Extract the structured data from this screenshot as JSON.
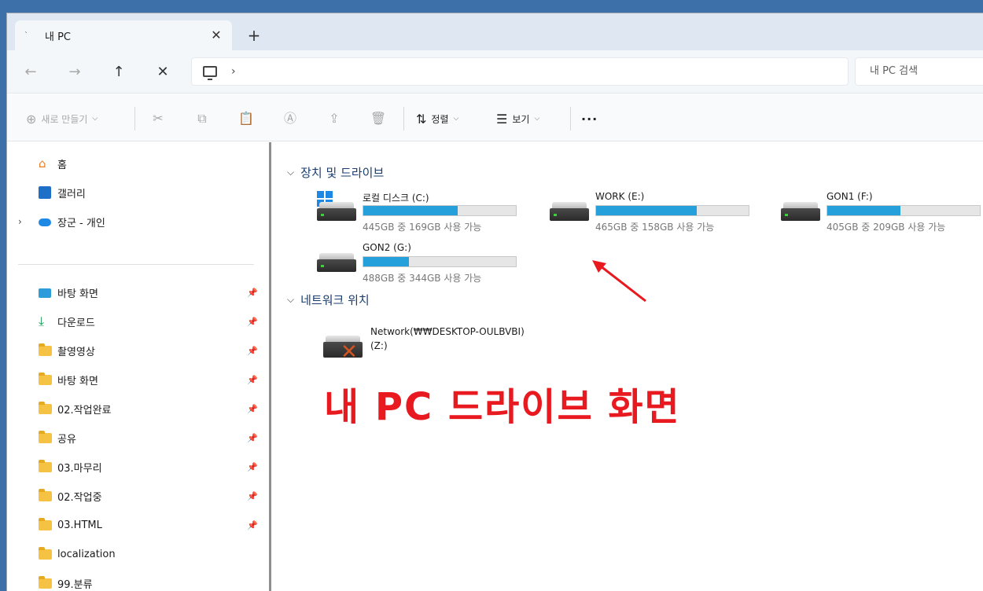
{
  "window": {
    "tab_label": "내 PC",
    "tab_close": "✕",
    "new_tab": "+"
  },
  "nav": {
    "back": "←",
    "forward": "→",
    "up": "↑",
    "close": "✕",
    "address_chevron": "›",
    "search_placeholder": "내 PC 검색"
  },
  "toolbar": {
    "new_label": "새로 만들기",
    "sort_label": "정렬",
    "view_label": "보기",
    "more_label": "···"
  },
  "sidebar": {
    "items": [
      {
        "label": "홈",
        "icon": "home-icon"
      },
      {
        "label": "갤러리",
        "icon": "gallery-icon"
      },
      {
        "label": "장군 - 개인",
        "icon": "onedrive-icon"
      }
    ],
    "quick_access": [
      {
        "label": "바탕 화면",
        "icon": "desktop-icon",
        "pinned": true
      },
      {
        "label": "다운로드",
        "icon": "download-icon",
        "pinned": true
      },
      {
        "label": "촬영영상",
        "icon": "folder-icon",
        "pinned": true
      },
      {
        "label": "바탕 화면",
        "icon": "folder-icon",
        "pinned": true
      },
      {
        "label": "02.작업완료",
        "icon": "folder-icon",
        "pinned": true
      },
      {
        "label": "공유",
        "icon": "folder-icon",
        "pinned": true
      },
      {
        "label": "03.마무리",
        "icon": "folder-icon",
        "pinned": true
      },
      {
        "label": "02.작업중",
        "icon": "folder-icon",
        "pinned": true
      },
      {
        "label": "03.HTML",
        "icon": "folder-icon",
        "pinned": true
      },
      {
        "label": "localization",
        "icon": "folder-icon",
        "pinned": false
      },
      {
        "label": "99.분류",
        "icon": "folder-icon",
        "pinned": false
      }
    ]
  },
  "content": {
    "devices_header": "장치 및 드라이브",
    "drives": [
      {
        "name": "로컬 디스크 (C:)",
        "info": "445GB 중 169GB 사용 가능",
        "used_fraction": 0.62,
        "system": true
      },
      {
        "name": "WORK (E:)",
        "info": "465GB 중 158GB 사용 가능",
        "used_fraction": 0.66,
        "system": false
      },
      {
        "name": "GON1 (F:)",
        "info": "405GB 중 209GB 사용 가능",
        "used_fraction": 0.48,
        "system": false
      },
      {
        "name": "GON2 (G:)",
        "info": "488GB 중 344GB 사용 가능",
        "used_fraction": 0.3,
        "system": false
      }
    ],
    "network_header": "네트워크 위치",
    "network_item": "Network(₩₩DESKTOP-OULBVBI) (Z:)"
  },
  "annotation": {
    "text": "내 PC 드라이브 화면",
    "color": "#e8191f"
  },
  "colors": {
    "accent": "#26a0da",
    "folder": "#f5c244"
  }
}
